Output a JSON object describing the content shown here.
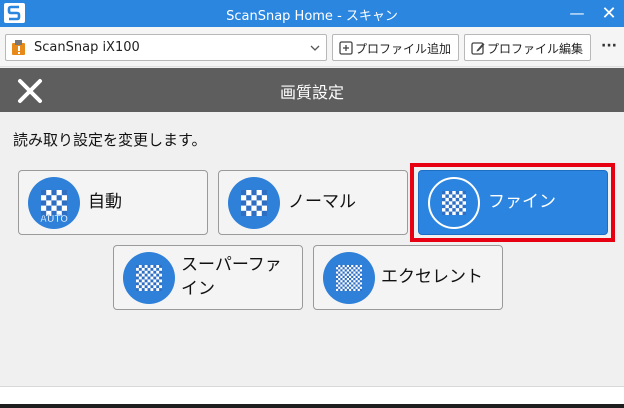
{
  "window": {
    "title": "ScanSnap Home - スキャン",
    "minimize": "—",
    "close": "✕"
  },
  "toolbar": {
    "scanner": "ScanSnap iX100",
    "add_profile": "プロファイル追加",
    "edit_profile": "プロファイル編集",
    "more": "···"
  },
  "header": {
    "title": "画質設定"
  },
  "instruction": "読み取り設定を変更します。",
  "options": [
    {
      "label": "自動",
      "icon": "auto-quality-icon",
      "badge": "AUTO",
      "selected": false
    },
    {
      "label": "ノーマル",
      "icon": "normal-quality-icon",
      "selected": false
    },
    {
      "label": "ファイン",
      "icon": "fine-quality-icon",
      "selected": true
    },
    {
      "label_line1": "スーパーファ",
      "label_line2": "イン",
      "icon": "super-fine-quality-icon",
      "selected": false
    },
    {
      "label": "エクセレント",
      "icon": "excellent-quality-icon",
      "selected": false
    }
  ],
  "colors": {
    "titlebar": "#2b86e0",
    "header": "#5e5e5e",
    "accent": "#2e80d9",
    "selected_frame": "#e60012"
  }
}
